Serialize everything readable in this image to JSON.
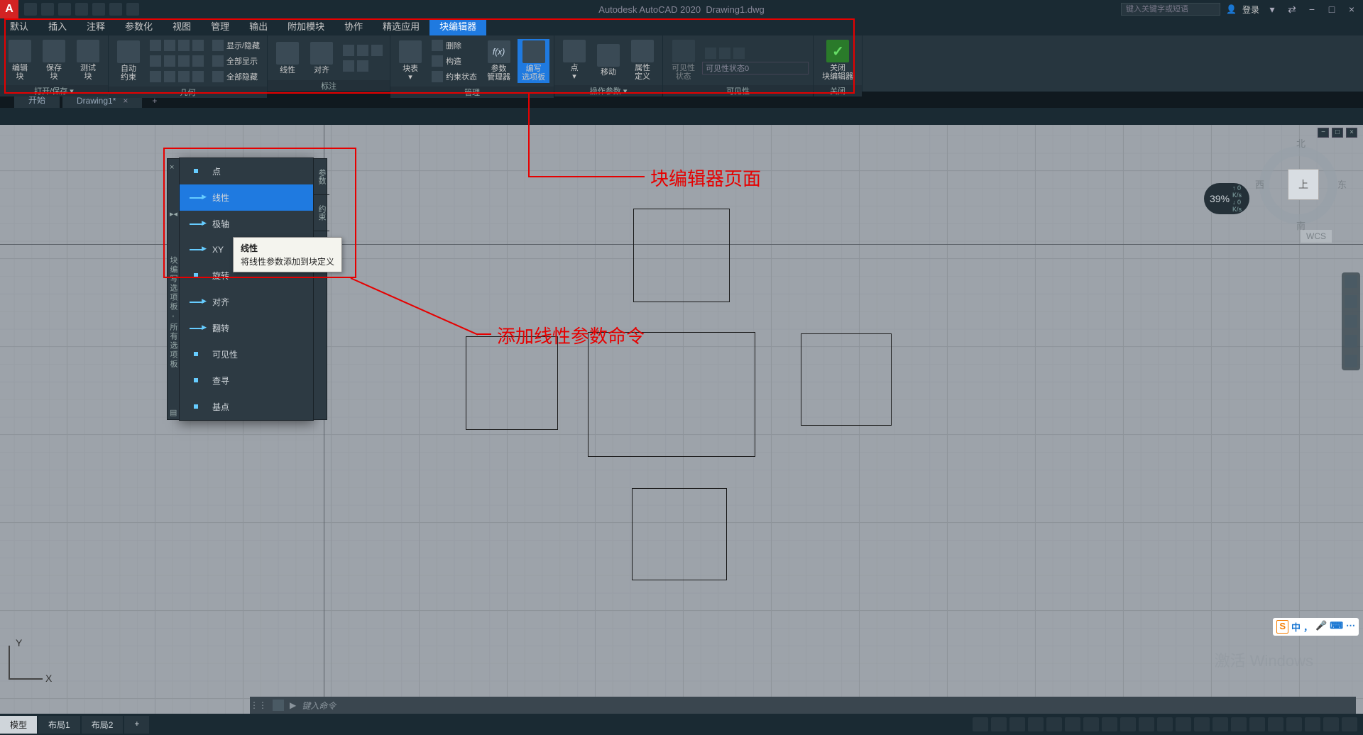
{
  "title": {
    "app": "Autodesk AutoCAD 2020",
    "file": "Drawing1.dwg"
  },
  "search_placeholder": "键入关键字或短语",
  "login_label": "登录",
  "menus": [
    "默认",
    "插入",
    "注释",
    "参数化",
    "视图",
    "管理",
    "输出",
    "附加模块",
    "协作",
    "精选应用",
    "块编辑器"
  ],
  "active_menu_idx": 10,
  "ribbon": {
    "p0": {
      "title": "打开/保存 ▾",
      "b0": "编辑\n块",
      "b1": "保存\n块",
      "b2": "测试\n块"
    },
    "p1": {
      "title": "几何",
      "b0": "自动\n约束",
      "r0": "显示/隐藏",
      "r1": "全部显示",
      "r2": "全部隐藏"
    },
    "p2": {
      "title": "标注",
      "b0": "线性",
      "b1": "对齐",
      "r0": "删除",
      "r1": "构造",
      "r2": "约束状态"
    },
    "p3": {
      "title": "管理",
      "b0": "块表\n▾",
      "b1": "参数\n管理器",
      "b2": "编写\n选项板"
    },
    "p4": {
      "title": "操作参数 ▾",
      "b0": "点\n▾",
      "b1": "移动"
    },
    "p5": {
      "title": "可见性",
      "b0": "属性\n定义",
      "b1": "可见性\n状态",
      "combo": "可见性状态0"
    },
    "p6": {
      "title": "关闭",
      "b0": "关闭\n块编辑器"
    }
  },
  "file_tabs": {
    "t0": "开始",
    "t1": "Drawing1*",
    "close": "×",
    "add": "+"
  },
  "palette": {
    "strip_title": "块编写选项板 - 所有选项板",
    "items": [
      "点",
      "线性",
      "极轴",
      "XY",
      "旋转",
      "对齐",
      "翻转",
      "可见性",
      "查寻",
      "基点"
    ],
    "hl_idx": 1,
    "side_tabs": [
      "参数",
      "约束"
    ]
  },
  "tooltip": {
    "title": "线性",
    "desc": "将线性参数添加到块定义"
  },
  "annotations": {
    "a1": "块编辑器页面",
    "a2": "添加线性参数命令"
  },
  "viewcube": {
    "face": "上",
    "n": "北",
    "s": "南",
    "e": "东",
    "w": "西",
    "wcs": "WCS"
  },
  "perf": {
    "pct": "39%",
    "u0": "0 K/s",
    "u1": "0 K/s"
  },
  "ucs": {
    "x": "X",
    "y": "Y"
  },
  "cmd": {
    "prompt": "键入命令",
    "arrow": "▶"
  },
  "status": {
    "tabs": [
      "模型",
      "布局1",
      "布局2"
    ],
    "add": "+"
  },
  "ime": {
    "s": "S",
    "c": "中",
    "m": "•",
    "mic": "🎤",
    "kb": "⌨",
    "dots": "⋯"
  },
  "watermark": "激活 Windows",
  "viewport_ctl": [
    "−",
    "□",
    "×"
  ]
}
